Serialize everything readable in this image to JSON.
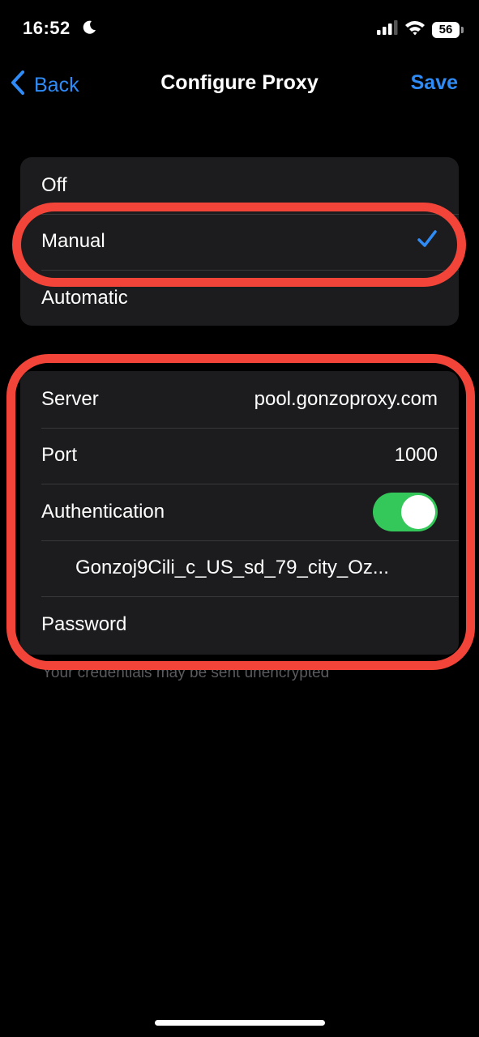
{
  "status_bar": {
    "time": "16:52",
    "battery": "56",
    "icons": [
      "moon-icon",
      "signal-icon",
      "wifi-icon",
      "battery-icon"
    ]
  },
  "nav": {
    "back_label": "Back",
    "title": "Configure Proxy",
    "save_label": "Save"
  },
  "mode_options": {
    "off": "Off",
    "manual": "Manual",
    "automatic": "Automatic",
    "selected": "Manual"
  },
  "settings": {
    "server_label": "Server",
    "server_value": "pool.gonzoproxy.com",
    "port_label": "Port",
    "port_value": "1000",
    "authentication_label": "Authentication",
    "authentication_enabled": true,
    "username_value": "Gonzoj9Cili_c_US_sd_79_city_Oz...",
    "password_label": "Password"
  },
  "footer_note": "Your credentials may be sent unencrypted",
  "colors": {
    "accent": "#2f8cf6",
    "toggle_on": "#34c759",
    "highlight": "#f24438",
    "group_bg": "#1c1c1e"
  }
}
